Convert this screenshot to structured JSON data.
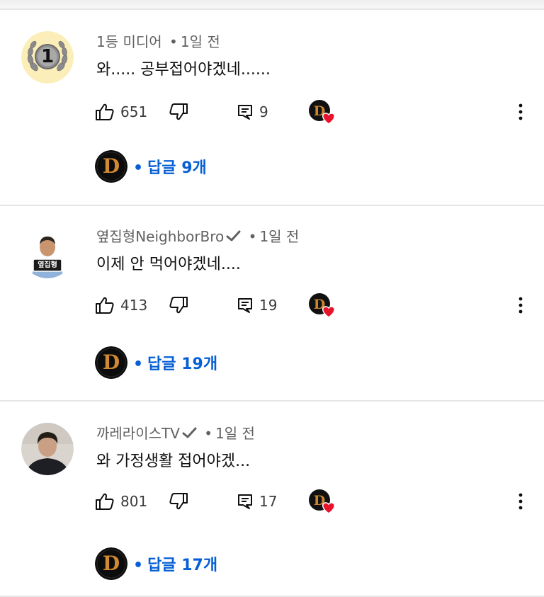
{
  "comments": [
    {
      "author": "1등 미디어",
      "verified": false,
      "separator": "•",
      "time": "1일 전",
      "text": "와..... 공부접어야겠네......",
      "likes": "651",
      "reply_count": "9",
      "replies_link": "답글 9개",
      "avatar_badge_digit": "1"
    },
    {
      "author": "옆집형NeighborBro",
      "verified": true,
      "separator": "•",
      "time": "1일 전",
      "text": "이제 안 먹어야겠네....",
      "likes": "413",
      "reply_count": "19",
      "replies_link": "답글 19개",
      "avatar_sign_text": "옆집형"
    },
    {
      "author": "까레라이스TV",
      "verified": true,
      "separator": "•",
      "time": "1일 전",
      "text": "와 가정생활 접어야겠...",
      "likes": "801",
      "reply_count": "17",
      "replies_link": "답글 17개"
    }
  ],
  "creator_logo_letter": "D",
  "colors": {
    "reply_link": "#065fd4",
    "meta": "#606060",
    "heart": "#e8132b",
    "divider": "#e6e6e6"
  },
  "icons": [
    "thumb-up-icon",
    "thumb-down-icon",
    "reply-icon",
    "creator-heart-icon",
    "more-vert-icon"
  ]
}
